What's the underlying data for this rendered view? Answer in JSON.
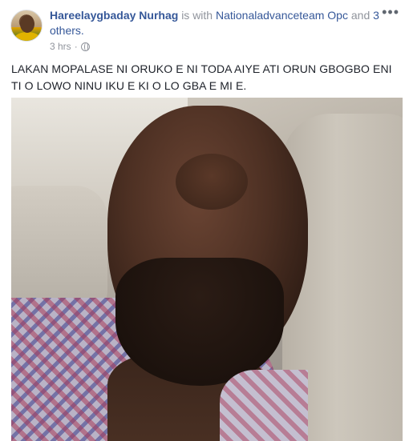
{
  "post": {
    "author": "Hareelaygbaday Nurhag",
    "with_text": "is with",
    "tagged": "Nationaladvanceteam Opc",
    "and_text": "and",
    "others": "3 others.",
    "time": "3 hrs",
    "dot": "·",
    "caption": "LAKAN MOPALASE NI ORUKO E NI TODA AIYE ATI ORUN GBOGBO ENI TI O LOWO NINU IKU E KI O LO GBA E MI E.",
    "more_glyph": "•••"
  },
  "icons": {
    "privacy": "globe-icon",
    "menu": "more-options-icon"
  },
  "colors": {
    "link": "#365899",
    "meta": "#90949c",
    "text": "#1d2129"
  }
}
